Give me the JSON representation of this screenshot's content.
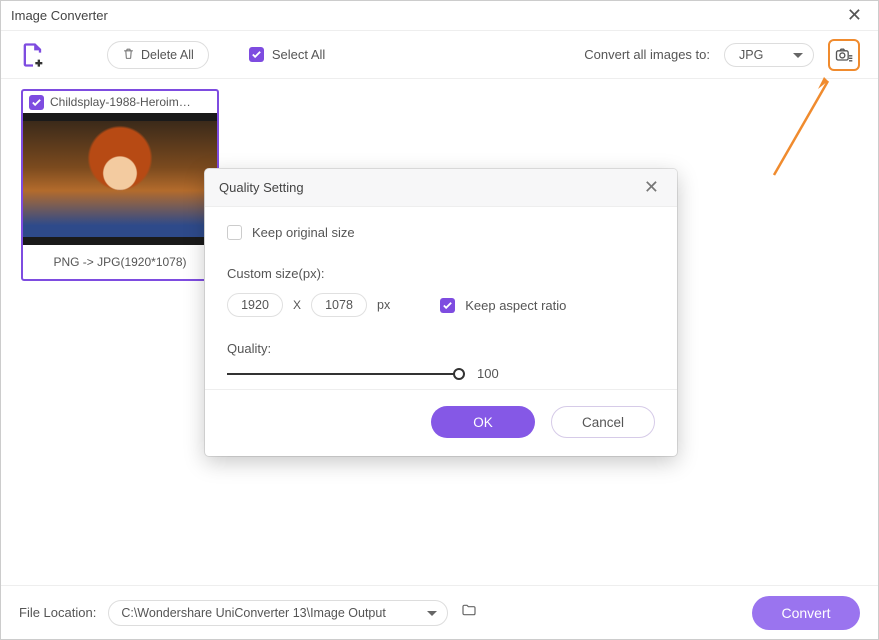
{
  "window": {
    "title": "Image Converter"
  },
  "toolbar": {
    "delete_all_label": "Delete All",
    "select_all_label": "Select All",
    "convert_all_label": "Convert all images to:",
    "format_selected": "JPG"
  },
  "thumbnail": {
    "filename": "Childsplay-1988-Heroim…",
    "conversion": "PNG -> JPG(1920*1078)"
  },
  "dialog": {
    "title": "Quality Setting",
    "keep_original_label": "Keep original size",
    "custom_size_label": "Custom size(px):",
    "width": "1920",
    "height": "1078",
    "x": "X",
    "px": "px",
    "keep_aspect_label": "Keep aspect ratio",
    "quality_label": "Quality:",
    "quality_value": "100",
    "ok_label": "OK",
    "cancel_label": "Cancel"
  },
  "footer": {
    "file_location_label": "File Location:",
    "path": "C:\\Wondershare UniConverter 13\\Image Output",
    "convert_label": "Convert"
  }
}
